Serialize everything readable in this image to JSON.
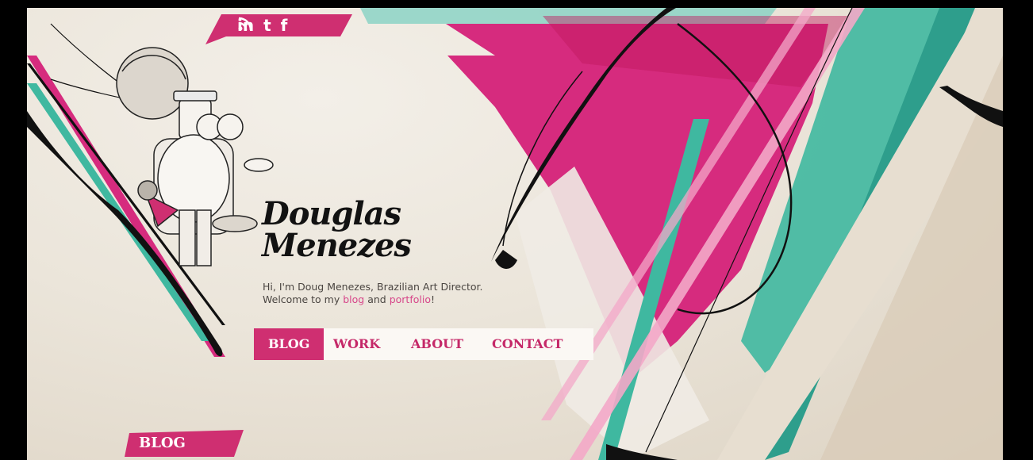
{
  "social": {
    "links": [
      {
        "name": "linkedin-icon",
        "label": "in"
      },
      {
        "name": "twitter-icon",
        "label": "t"
      },
      {
        "name": "facebook-icon",
        "label": "f"
      },
      {
        "name": "rss-icon",
        "label": " "
      }
    ]
  },
  "hero": {
    "title_line1": "Douglas",
    "title_line2": "Menezes",
    "intro_line1": "Hi, I'm Doug Menezes, Brazilian Art Director.",
    "intro_prefix": "Welcome to my ",
    "intro_link1": "blog",
    "intro_mid": " and ",
    "intro_link2": "portfolio",
    "intro_suffix": "!"
  },
  "nav": {
    "items": [
      {
        "label": "BLOG",
        "active": true
      },
      {
        "label": "WORK",
        "active": false
      },
      {
        "label": "ABOUT",
        "active": false
      },
      {
        "label": "CONTACT",
        "active": false
      }
    ]
  },
  "footer": {
    "section_label": "BLOG"
  },
  "colors": {
    "magenta": "#cf2f71",
    "teal": "#3fb8a0",
    "paper": "#ebe5da",
    "ink": "#121212"
  }
}
